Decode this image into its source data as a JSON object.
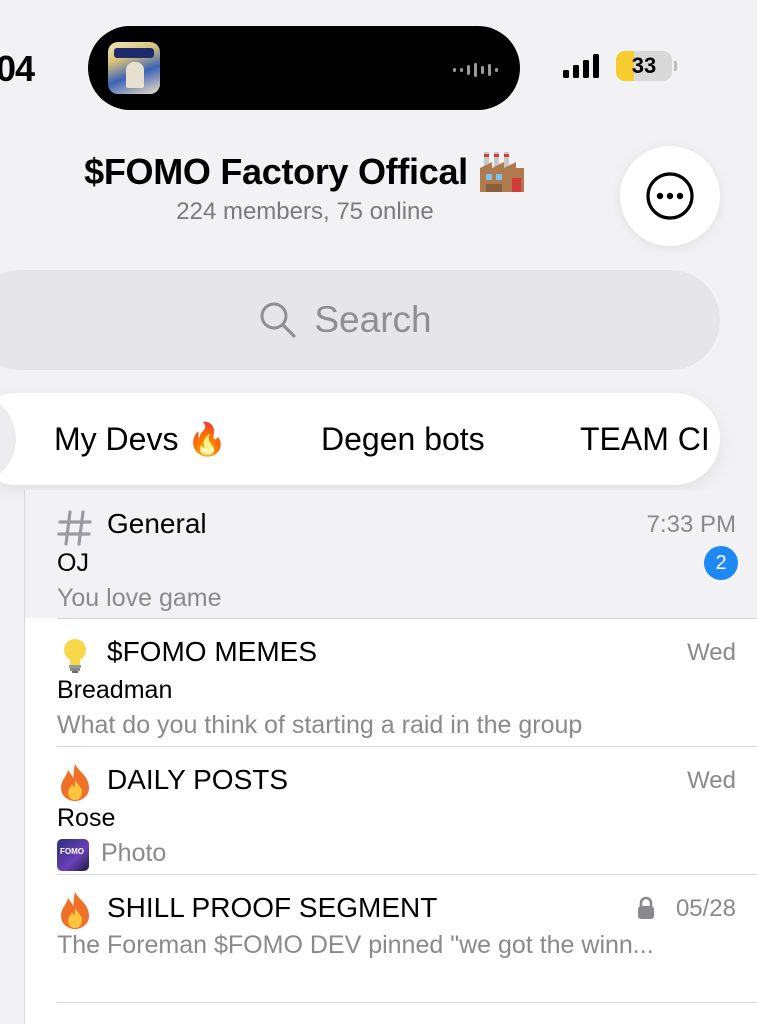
{
  "status_bar": {
    "time": "04",
    "battery_percent": "33",
    "battery_level": 0.33
  },
  "header": {
    "title": "$FOMO Factory Offical",
    "title_icon": "factory-icon",
    "subtitle": "224 members, 75 online",
    "more_icon": "ellipsis-circle-icon"
  },
  "search": {
    "placeholder": "Search",
    "icon": "search-icon"
  },
  "tabs": [
    {
      "label": "My Devs 🔥"
    },
    {
      "label": "Degen bots"
    },
    {
      "label": "TEAM CI"
    }
  ],
  "topics": [
    {
      "icon": "hash-icon",
      "name": "General",
      "time": "7:33 PM",
      "sender": "OJ",
      "preview": "You love game",
      "unread": "2"
    },
    {
      "icon": "lightbulb-icon",
      "name": "$FOMO MEMES",
      "time": "Wed",
      "sender": "Breadman",
      "preview": "What do you think of starting a raid in the group"
    },
    {
      "icon": "fire-icon",
      "name": "DAILY POSTS",
      "time": "Wed",
      "sender": "Rose",
      "preview": "Photo"
    },
    {
      "icon": "fire-icon",
      "name": "SHILL PROOF SEGMENT",
      "time": "05/28",
      "preview": "The Foreman $FOMO DEV pinned \"we got the winn..."
    }
  ],
  "colors": {
    "accent_blue": "#1e88f5",
    "battery_yellow": "#f6cc2e",
    "secondary_text": "#8a8a8e"
  }
}
